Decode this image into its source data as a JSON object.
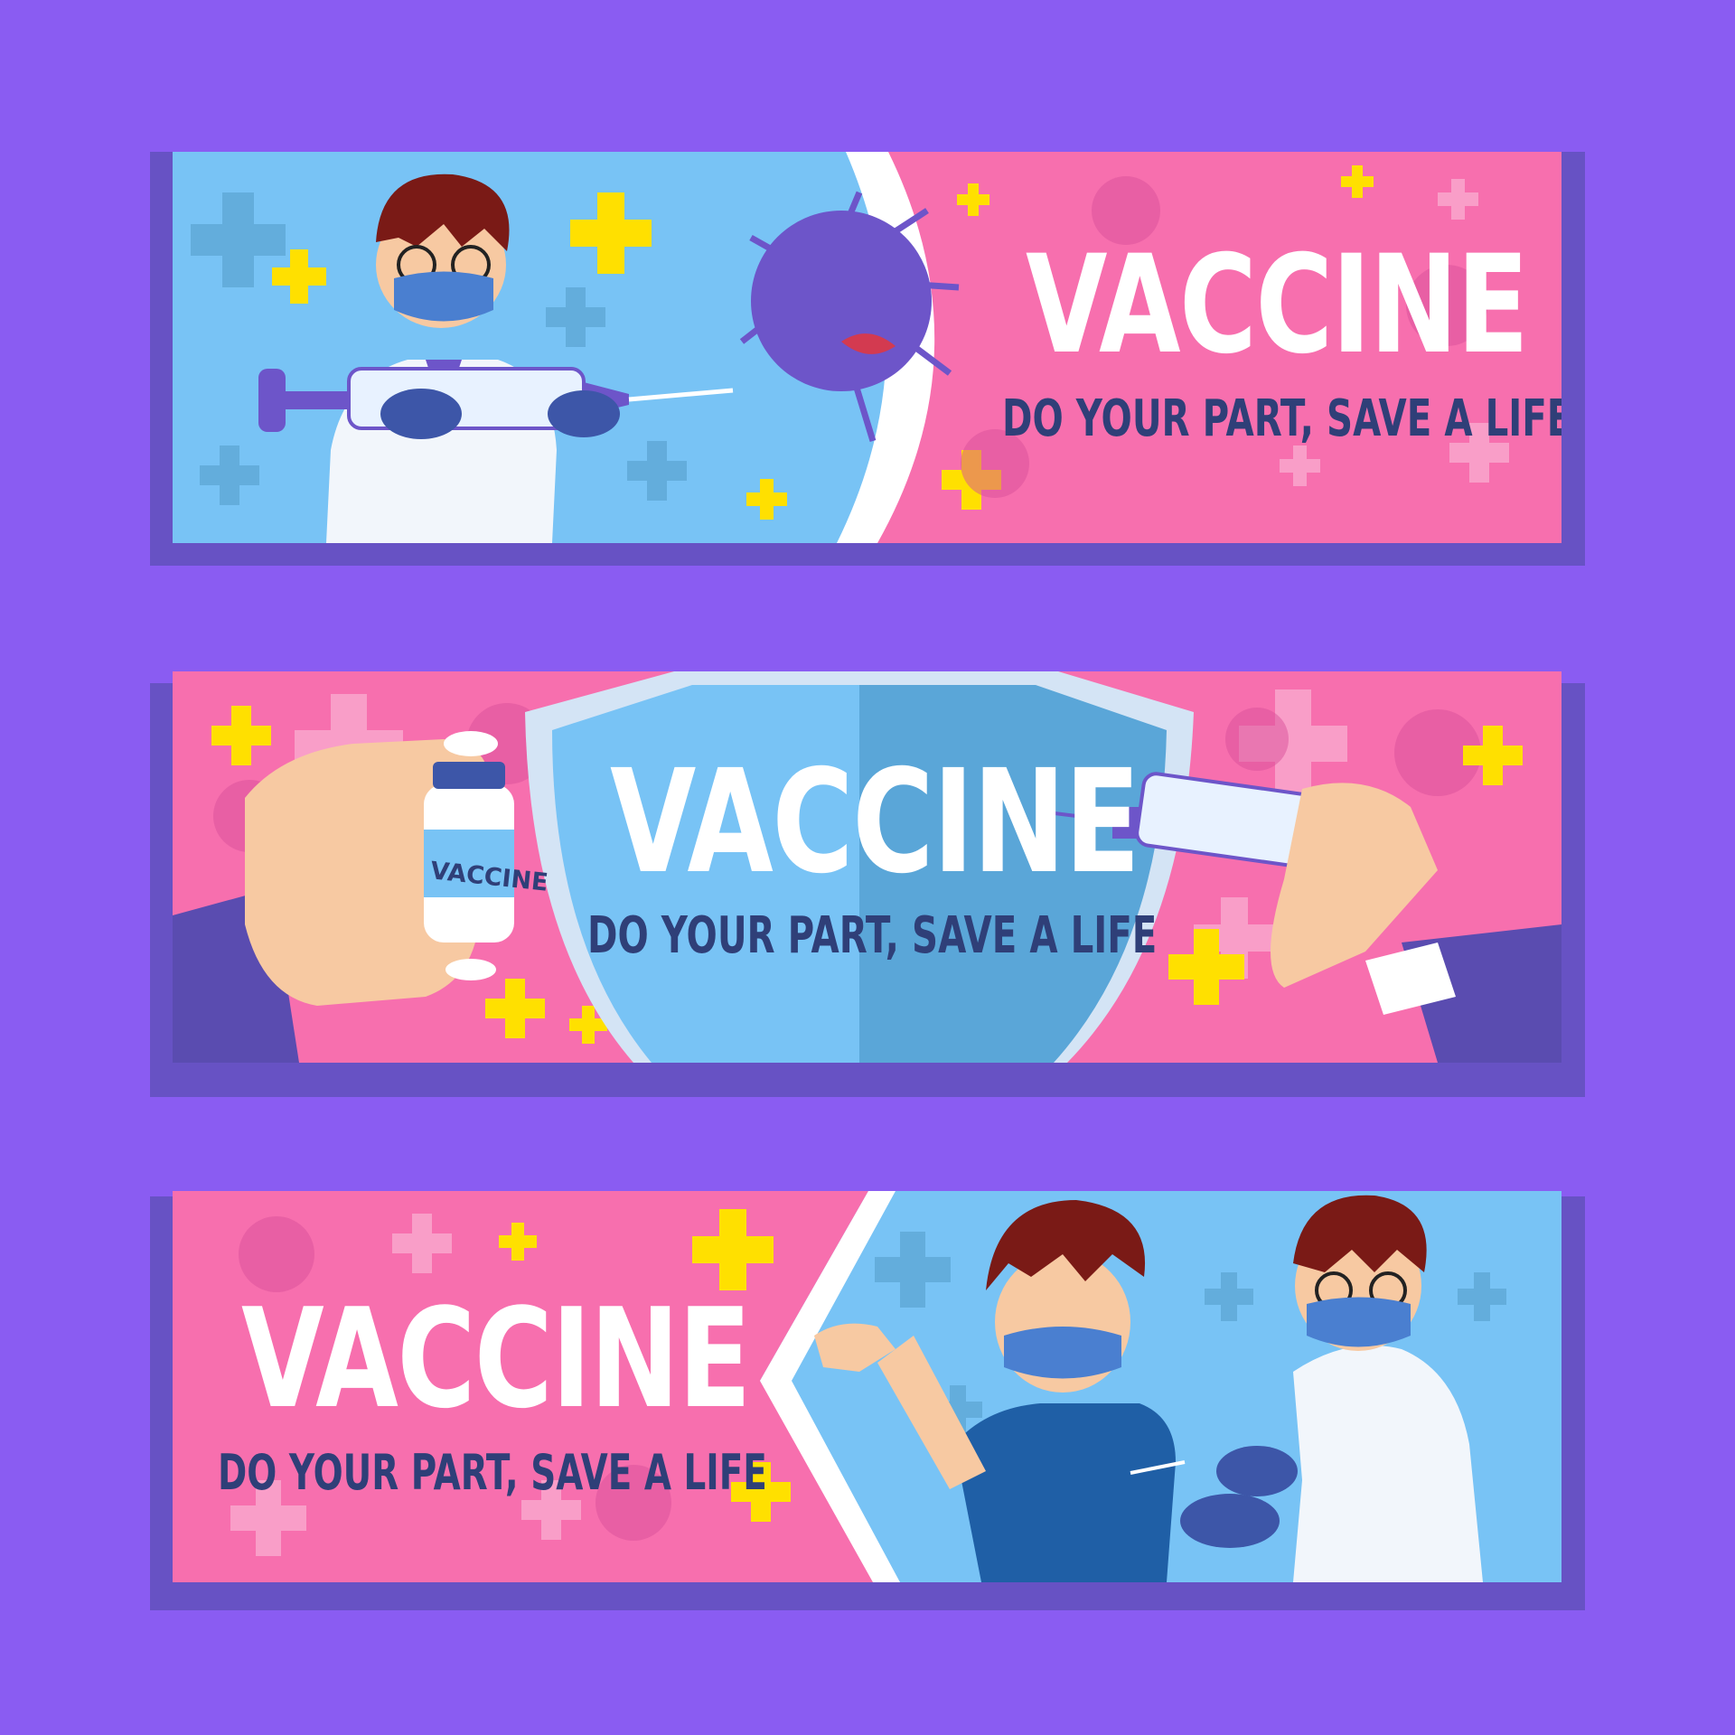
{
  "banners": [
    {
      "title": "VACCINE",
      "tagline": "DO YOUR PART, SAVE A LIFE"
    },
    {
      "title": "VACCINE",
      "tagline": "DO YOUR PART, SAVE A LIFE",
      "vial_label": "VACCINE"
    },
    {
      "title": "VACCINE",
      "tagline": "DO YOUR PART, SAVE A LIFE"
    }
  ],
  "colors": {
    "background": "#8a5cf2",
    "banner_shadow": "#6752c4",
    "pink": "#f76fae",
    "blue": "#78c3f5",
    "yellow_cross": "#ffe000",
    "tagline": "#2f3f78",
    "virus": "#6d55c9"
  },
  "icons": [
    "medical-cross-icon",
    "virus-icon",
    "syringe-icon",
    "vaccine-vial-icon",
    "shield-icon"
  ]
}
